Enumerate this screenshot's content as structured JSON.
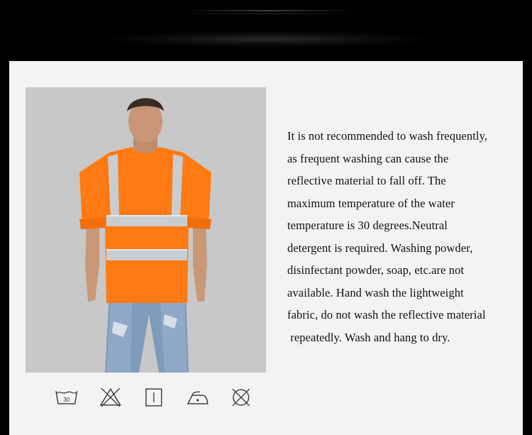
{
  "description": {
    "lines": [
      "It is not recommended to wash frequently,",
      "as frequent washing can cause the",
      "reflective material to fall off. The",
      "maximum temperature of the water",
      "temperature is 30 degrees.Neutral",
      "detergent is required. Washing powder,",
      "disinfectant powder, soap, etc.are not",
      "available. Hand wash the lightweight",
      "fabric, do not wash the reflective material",
      " repeatedly. Wash and hang to dry."
    ]
  },
  "care_icons": [
    {
      "name": "wash-30-icon",
      "label": "30"
    },
    {
      "name": "do-not-bleach-icon"
    },
    {
      "name": "hang-dry-icon"
    },
    {
      "name": "iron-icon"
    },
    {
      "name": "do-not-dry-clean-icon"
    }
  ],
  "colors": {
    "shirt": "#ff7a12",
    "reflective": "#c8cdd2",
    "panel": "#f3f3f3",
    "photo_bg": "#c9c9c9"
  }
}
